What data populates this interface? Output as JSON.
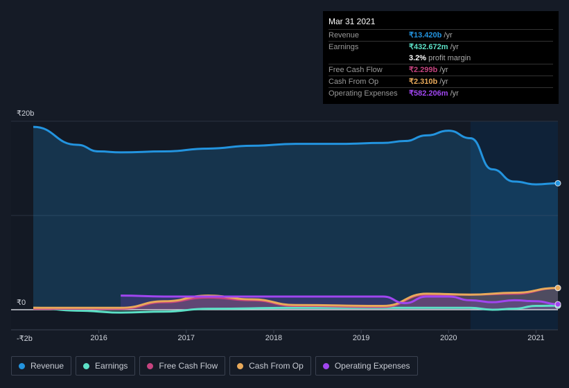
{
  "tooltip": {
    "date": "Mar 31 2021",
    "rows": [
      {
        "label": "Revenue",
        "value": "₹13.420b",
        "unit": " /yr",
        "color": "#2394df"
      },
      {
        "label": "Earnings",
        "value": "₹432.672m",
        "unit": " /yr",
        "color": "#5ce0c6"
      },
      {
        "label": "",
        "value": "3.2%",
        "unit": " profit margin",
        "color": "#ffffff"
      },
      {
        "label": "Free Cash Flow",
        "value": "₹2.299b",
        "unit": " /yr",
        "color": "#c5437f"
      },
      {
        "label": "Cash From Op",
        "value": "₹2.310b",
        "unit": " /yr",
        "color": "#e8a95a"
      },
      {
        "label": "Operating Expenses",
        "value": "₹582.206m",
        "unit": " /yr",
        "color": "#a046f0"
      }
    ]
  },
  "chart_data": {
    "type": "area",
    "y_tick_labels": [
      "₹20b",
      "₹0",
      "-₹2b"
    ],
    "y_ticks": [
      20,
      0,
      -2
    ],
    "ylim": [
      -2.2,
      20
    ],
    "xlim": [
      2015.25,
      2021.25
    ],
    "x_ticks": [
      2016,
      2017,
      2018,
      2019,
      2020,
      2021
    ],
    "x_tick_labels": [
      "2016",
      "2017",
      "2018",
      "2019",
      "2020",
      "2021"
    ],
    "highlight_from": 2020.25,
    "legend_position": "bottom",
    "series": [
      {
        "name": "Revenue",
        "color": "#2394df",
        "x": [
          2015.25,
          2015.75,
          2016,
          2016.25,
          2016.75,
          2017.25,
          2017.75,
          2018.25,
          2018.75,
          2019.25,
          2019.5,
          2019.75,
          2020,
          2020.25,
          2020.5,
          2020.75,
          2021,
          2021.25
        ],
        "values": [
          19.4,
          17.5,
          16.8,
          16.7,
          16.8,
          17.1,
          17.4,
          17.6,
          17.6,
          17.7,
          17.9,
          18.5,
          19.0,
          18.2,
          14.9,
          13.6,
          13.3,
          13.42
        ]
      },
      {
        "name": "Earnings",
        "color": "#5ce0c6",
        "x": [
          2015.25,
          2015.75,
          2016.25,
          2016.75,
          2017.25,
          2018.25,
          2019.25,
          2020.25,
          2020.5,
          2020.75,
          2021,
          2021.25
        ],
        "values": [
          0.2,
          -0.1,
          -0.3,
          -0.2,
          0.1,
          0.2,
          0.2,
          0.2,
          0.0,
          0.1,
          0.4,
          0.43
        ]
      },
      {
        "name": "Free Cash Flow",
        "color": "#c5437f",
        "x": [
          2015.25,
          2016.25,
          2016.75,
          2017.25,
          2017.75,
          2018.25,
          2019.25,
          2019.75,
          2020.25,
          2020.75,
          2021.25
        ],
        "values": [
          0.1,
          0.1,
          0.8,
          1.3,
          1.0,
          0.4,
          0.3,
          1.6,
          1.6,
          1.7,
          2.3
        ]
      },
      {
        "name": "Cash From Op",
        "color": "#e8a95a",
        "x": [
          2015.25,
          2016.25,
          2016.75,
          2017.25,
          2017.75,
          2018.25,
          2019.25,
          2019.75,
          2020.25,
          2020.75,
          2021.25
        ],
        "values": [
          0.2,
          0.2,
          0.9,
          1.5,
          1.1,
          0.5,
          0.4,
          1.7,
          1.6,
          1.8,
          2.31
        ]
      },
      {
        "name": "Operating Expenses",
        "color": "#a046f0",
        "x": [
          2016.25,
          2016.75,
          2017.25,
          2018.25,
          2019.25,
          2019.5,
          2019.75,
          2020,
          2020.25,
          2020.5,
          2020.75,
          2021,
          2021.25
        ],
        "values": [
          1.5,
          1.4,
          1.4,
          1.4,
          1.4,
          0.7,
          1.4,
          1.4,
          1.0,
          0.8,
          1.0,
          0.9,
          0.58
        ]
      }
    ]
  }
}
